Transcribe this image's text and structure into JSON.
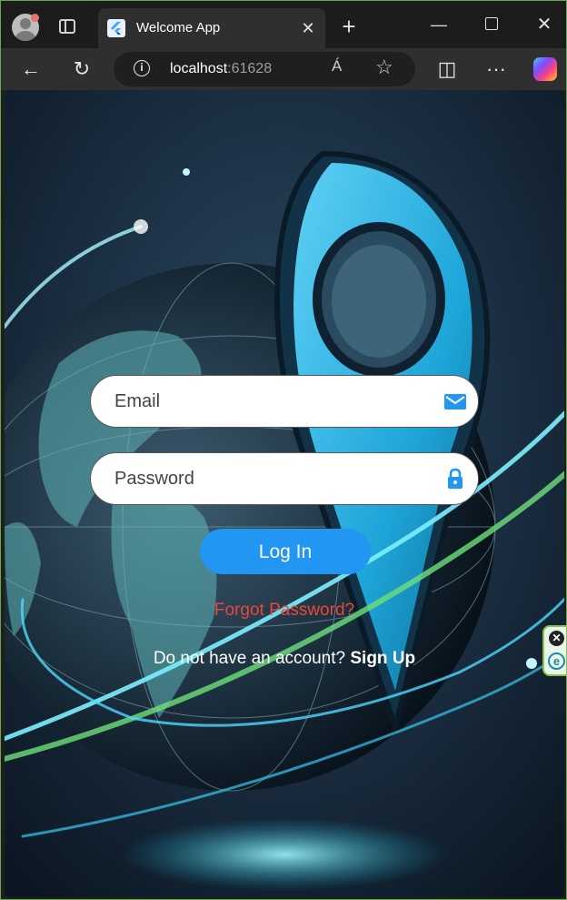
{
  "browser": {
    "tab": {
      "title": "Welcome App"
    },
    "address": {
      "host": "localhost",
      "port": ":61628"
    },
    "icons": {
      "profile": "profile-avatar-icon",
      "tab_actions": "tab-actions-icon",
      "favicon": "flutter-icon",
      "tab_close": "close-icon",
      "new_tab": "plus-icon",
      "minimize": "minimize-icon",
      "maximize": "maximize-icon",
      "window_close": "close-icon",
      "back": "arrow-left-icon",
      "refresh": "refresh-icon",
      "site_info": "info-icon",
      "read_aloud": "read-aloud-icon",
      "favorite": "star-icon",
      "split_screen": "split-screen-icon",
      "more": "more-icon",
      "copilot": "copilot-icon"
    },
    "glyphs": {
      "tab_close": "✕",
      "new_tab": "+",
      "minimize": "—",
      "window_close": "✕",
      "back": "←",
      "refresh": "↻",
      "site_info": "i",
      "read_aloud": "Á",
      "favorite": "☆",
      "split_screen": "◫",
      "more": "···",
      "ext_close": "✕",
      "ext_logo": "e"
    }
  },
  "login": {
    "email_placeholder": "Email",
    "password_placeholder": "Password",
    "login_label": "Log In",
    "forgot_label": "Forgot Password?",
    "no_account_text": "Do not have an account? ",
    "signup_label": "Sign Up",
    "icons": {
      "email": "mail-icon",
      "password": "lock-icon"
    }
  },
  "colors": {
    "accent": "#2196f3",
    "forgot_link": "#e8473a",
    "field_bg": "#ffffff"
  }
}
